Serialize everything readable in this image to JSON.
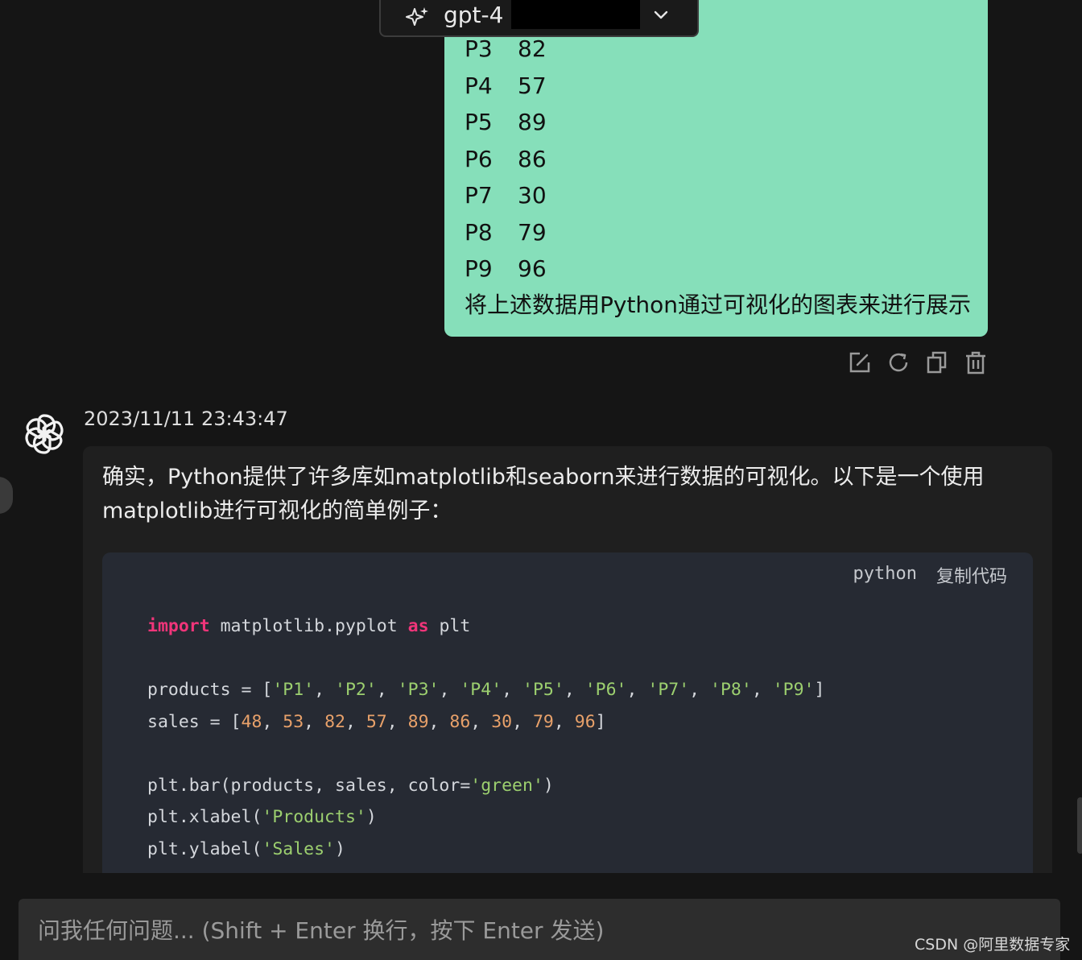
{
  "model_selector": {
    "model": "gpt-4"
  },
  "user_message": {
    "rows": [
      {
        "product": "P3",
        "value": "82"
      },
      {
        "product": "P4",
        "value": "57"
      },
      {
        "product": "P5",
        "value": "89"
      },
      {
        "product": "P6",
        "value": "86"
      },
      {
        "product": "P7",
        "value": "30"
      },
      {
        "product": "P8",
        "value": "79"
      },
      {
        "product": "P9",
        "value": "96"
      }
    ],
    "question": "将上述数据用Python通过可视化的图表来进行展示"
  },
  "assistant_message": {
    "timestamp": "2023/11/11 23:43:47",
    "text": "确实，Python提供了许多库如matplotlib和seaborn来进行数据的可视化。以下是一个使用\nmatplotlib进行可视化的简单例子：",
    "code": {
      "language": "python",
      "copy_label": "复制代码",
      "lines": [
        [
          {
            "t": "import",
            "c": "kw"
          },
          {
            "t": " matplotlib.pyplot "
          },
          {
            "t": "as",
            "c": "kw"
          },
          {
            "t": " plt"
          }
        ],
        [],
        [
          {
            "t": "products = ["
          },
          {
            "t": "'P1'",
            "c": "str"
          },
          {
            "t": ", "
          },
          {
            "t": "'P2'",
            "c": "str"
          },
          {
            "t": ", "
          },
          {
            "t": "'P3'",
            "c": "str"
          },
          {
            "t": ", "
          },
          {
            "t": "'P4'",
            "c": "str"
          },
          {
            "t": ", "
          },
          {
            "t": "'P5'",
            "c": "str"
          },
          {
            "t": ", "
          },
          {
            "t": "'P6'",
            "c": "str"
          },
          {
            "t": ", "
          },
          {
            "t": "'P7'",
            "c": "str"
          },
          {
            "t": ", "
          },
          {
            "t": "'P8'",
            "c": "str"
          },
          {
            "t": ", "
          },
          {
            "t": "'P9'",
            "c": "str"
          },
          {
            "t": "]"
          }
        ],
        [
          {
            "t": "sales = ["
          },
          {
            "t": "48",
            "c": "num"
          },
          {
            "t": ", "
          },
          {
            "t": "53",
            "c": "num"
          },
          {
            "t": ", "
          },
          {
            "t": "82",
            "c": "num"
          },
          {
            "t": ", "
          },
          {
            "t": "57",
            "c": "num"
          },
          {
            "t": ", "
          },
          {
            "t": "89",
            "c": "num"
          },
          {
            "t": ", "
          },
          {
            "t": "86",
            "c": "num"
          },
          {
            "t": ", "
          },
          {
            "t": "30",
            "c": "num"
          },
          {
            "t": ", "
          },
          {
            "t": "79",
            "c": "num"
          },
          {
            "t": ", "
          },
          {
            "t": "96",
            "c": "num"
          },
          {
            "t": "]"
          }
        ],
        [],
        [
          {
            "t": "plt.bar(products, sales, color="
          },
          {
            "t": "'green'",
            "c": "str"
          },
          {
            "t": ")"
          }
        ],
        [
          {
            "t": "plt.xlabel("
          },
          {
            "t": "'Products'",
            "c": "str"
          },
          {
            "t": ")"
          }
        ],
        [
          {
            "t": "plt.ylabel("
          },
          {
            "t": "'Sales'",
            "c": "str"
          },
          {
            "t": ")"
          }
        ]
      ]
    }
  },
  "input": {
    "placeholder": "问我任何问题... (Shift + Enter 换行，按下 Enter 发送)"
  },
  "watermark": "CSDN @阿里数据专家",
  "colors": {
    "user_bubble": "#86dfba",
    "background": "#151515",
    "code_keyword": "#f0357a",
    "code_string": "#9ccf6f",
    "code_number": "#e8a16a"
  },
  "icons": [
    "sparkle-icon",
    "chevron-down-icon",
    "edit-icon",
    "regenerate-icon",
    "copy-icon",
    "delete-icon",
    "openai-logo-icon"
  ]
}
